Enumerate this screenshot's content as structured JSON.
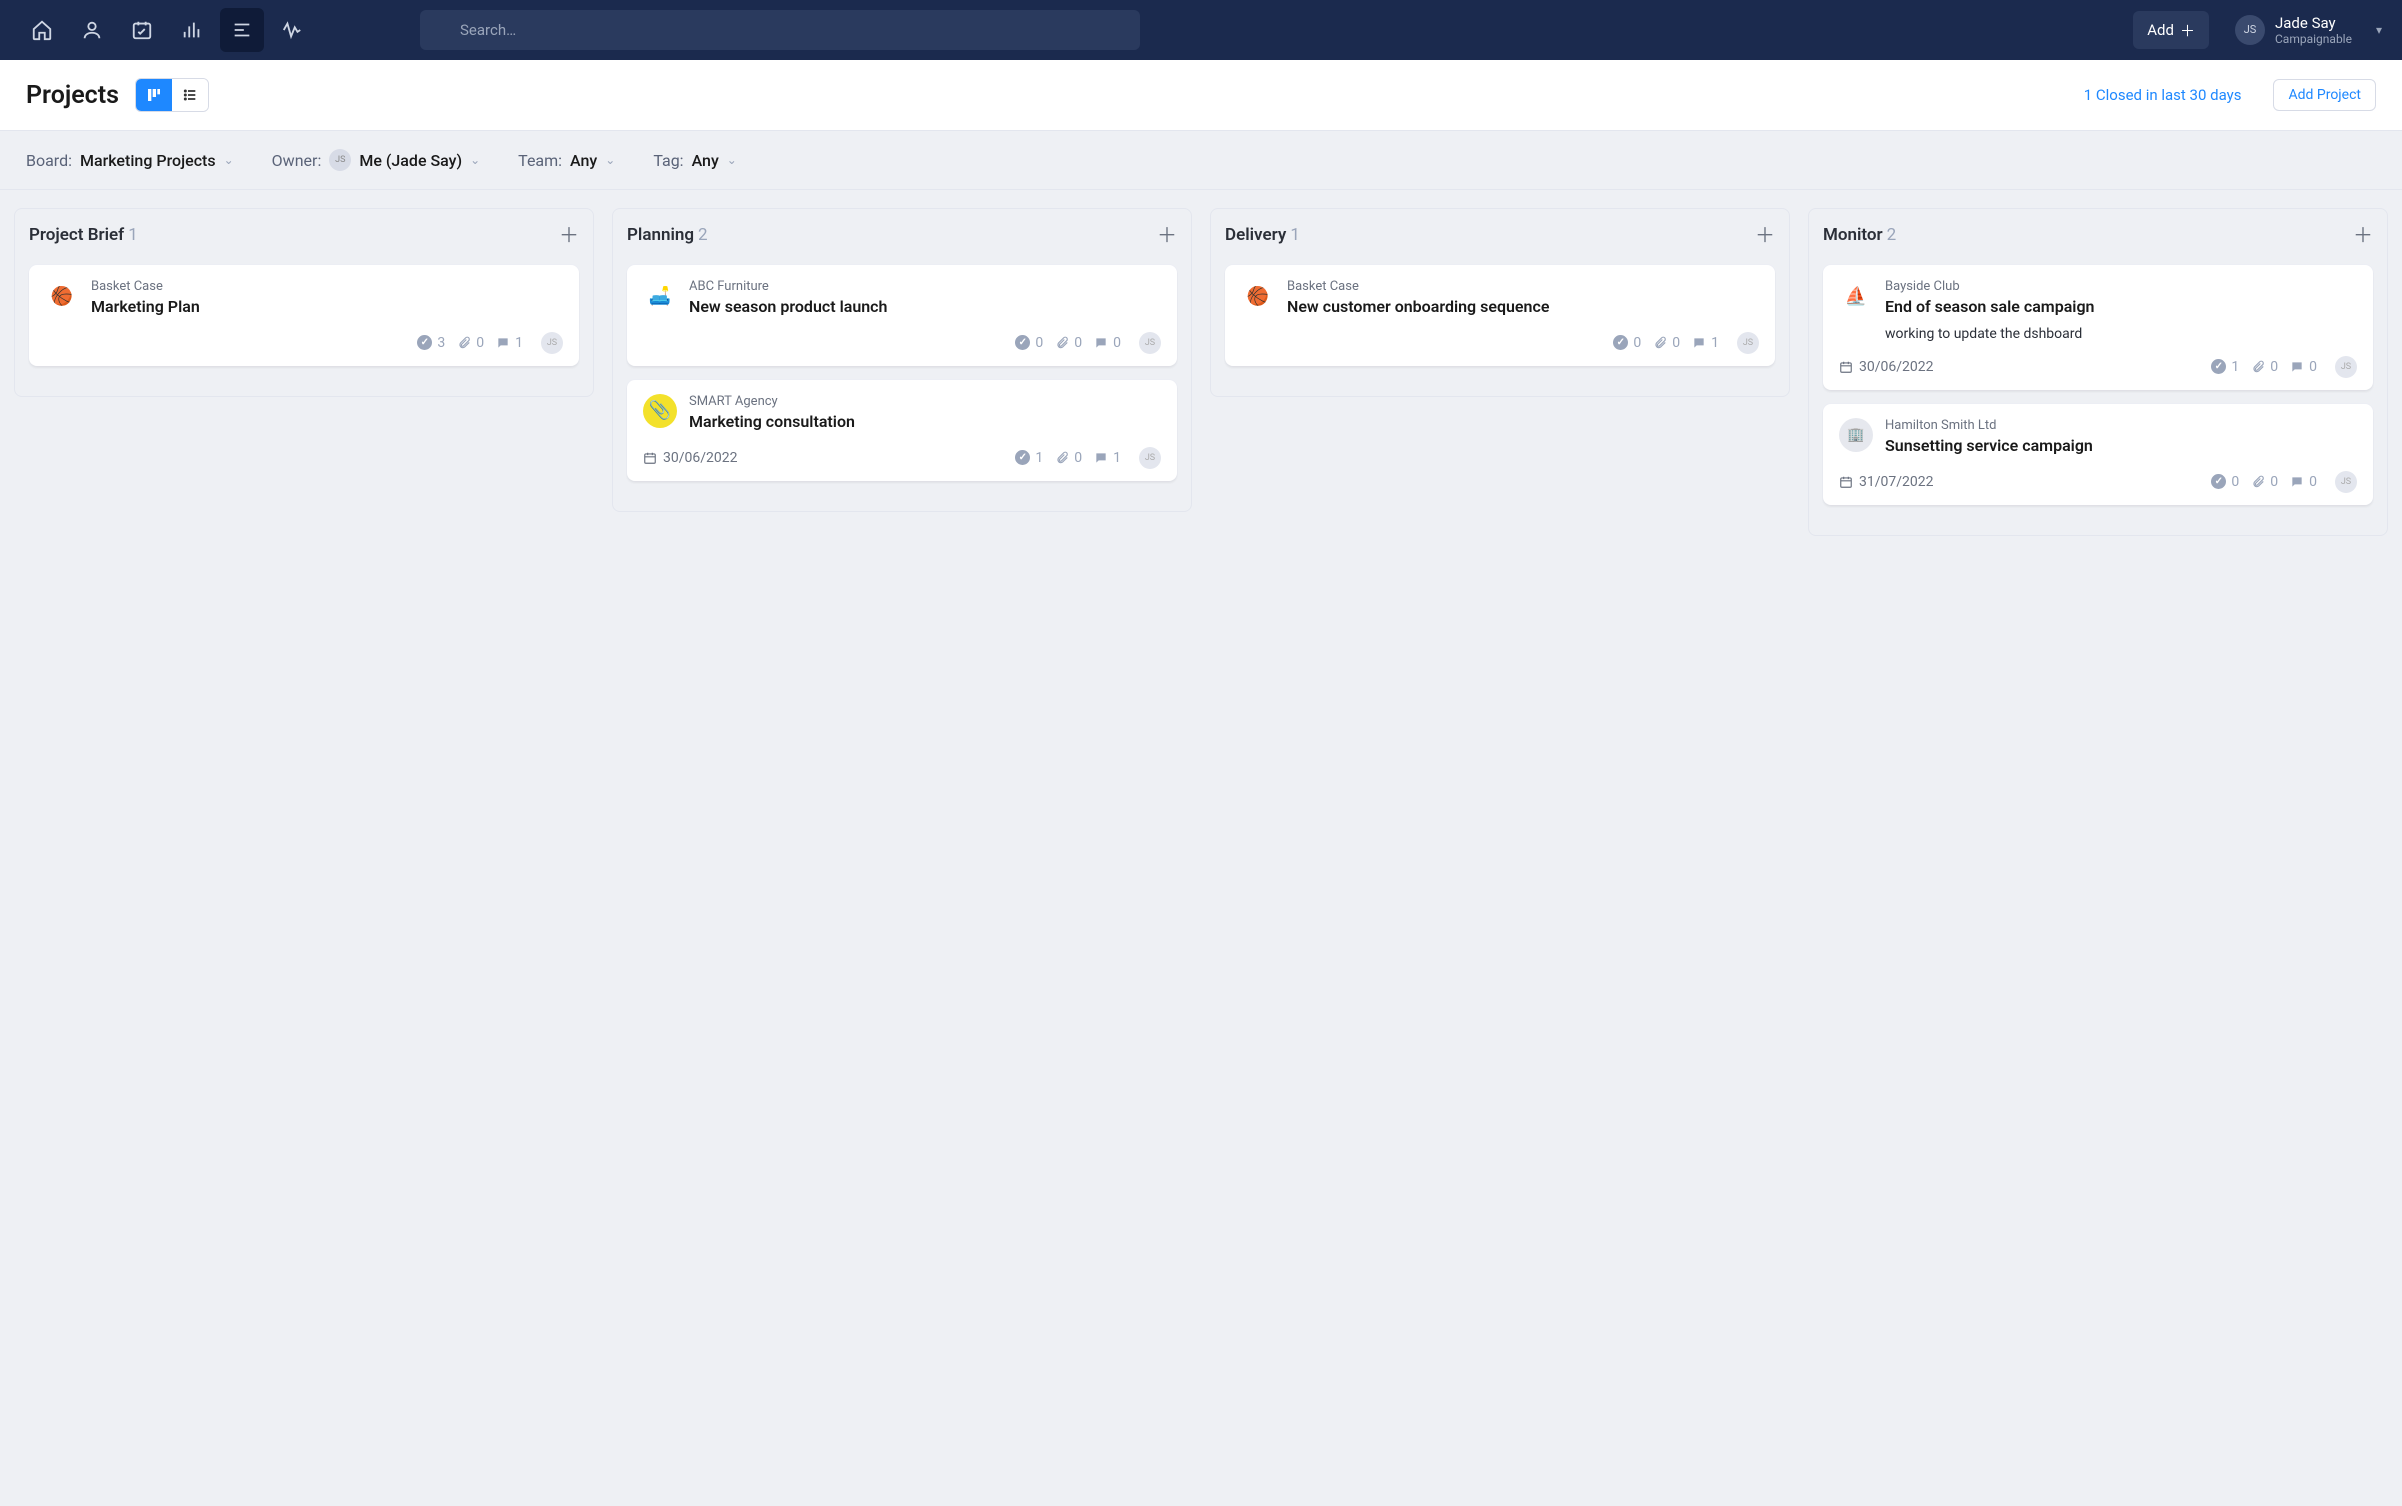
{
  "topbar": {
    "search_placeholder": "Search…",
    "add_label": "Add",
    "user_initials": "JS",
    "user_name": "Jade Say",
    "user_org": "Campaignable"
  },
  "page": {
    "title": "Projects",
    "closed_link": "1 Closed in last 30 days",
    "add_project_label": "Add Project"
  },
  "filters": {
    "board_label": "Board:",
    "board_value": "Marketing Projects",
    "owner_label": "Owner:",
    "owner_initials": "JS",
    "owner_value": "Me (Jade Say)",
    "team_label": "Team:",
    "team_value": "Any",
    "tag_label": "Tag:",
    "tag_value": "Any"
  },
  "columns": [
    {
      "title": "Project Brief",
      "count": "1",
      "cards": [
        {
          "client": "Basket Case",
          "title": "Marketing Plan",
          "desc": "",
          "date": "",
          "checks": "3",
          "attachments": "0",
          "comments": "1",
          "assignee": "JS",
          "iconClass": "ci-basket",
          "iconGlyph": "🏀"
        }
      ]
    },
    {
      "title": "Planning",
      "count": "2",
      "cards": [
        {
          "client": "ABC Furniture",
          "title": "New season product launch",
          "desc": "",
          "date": "",
          "checks": "0",
          "attachments": "0",
          "comments": "0",
          "assignee": "JS",
          "iconClass": "ci-furn",
          "iconGlyph": "🛋️"
        },
        {
          "client": "SMART Agency",
          "title": "Marketing consultation",
          "desc": "",
          "date": "30/06/2022",
          "checks": "1",
          "attachments": "0",
          "comments": "1",
          "assignee": "JS",
          "iconClass": "ci-smart",
          "iconGlyph": "📎"
        }
      ]
    },
    {
      "title": "Delivery",
      "count": "1",
      "cards": [
        {
          "client": "Basket Case",
          "title": "New customer onboarding sequence",
          "desc": "",
          "date": "",
          "checks": "0",
          "attachments": "0",
          "comments": "1",
          "assignee": "JS",
          "iconClass": "ci-basket",
          "iconGlyph": "🏀"
        }
      ]
    },
    {
      "title": "Monitor",
      "count": "2",
      "cards": [
        {
          "client": "Bayside Club",
          "title": "End of season sale campaign",
          "desc": "working to update the dshboard",
          "date": "30/06/2022",
          "checks": "1",
          "attachments": "0",
          "comments": "0",
          "assignee": "JS",
          "iconClass": "ci-bay",
          "iconGlyph": "⛵"
        },
        {
          "client": "Hamilton Smith Ltd",
          "title": "Sunsetting service campaign",
          "desc": "",
          "date": "31/07/2022",
          "checks": "0",
          "attachments": "0",
          "comments": "0",
          "assignee": "JS",
          "iconClass": "ci-ham",
          "iconGlyph": "🏢"
        }
      ]
    }
  ]
}
